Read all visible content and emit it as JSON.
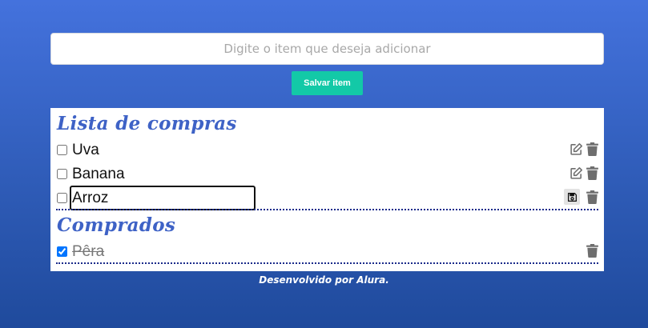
{
  "form": {
    "input_placeholder": "Digite o item que deseja adicionar",
    "input_value": "",
    "save_button_label": "Salvar item"
  },
  "shopping_list": {
    "title": "Lista de compras",
    "items": [
      {
        "label": "Uva",
        "checked": false,
        "editing": false
      },
      {
        "label": "Banana",
        "checked": false,
        "editing": false
      },
      {
        "label": "Arroz",
        "checked": false,
        "editing": true
      }
    ]
  },
  "purchased": {
    "title": "Comprados",
    "items": [
      {
        "label": "Pêra",
        "checked": true
      }
    ]
  },
  "footer": {
    "text": "Desenvolvido por Alura."
  },
  "icons": {
    "edit": "edit-icon",
    "delete": "trash-icon",
    "save": "floppy-disk-icon"
  },
  "colors": {
    "background_top": "#4472dd",
    "background_bottom": "#1f4a9c",
    "save_button": "#13c9a7",
    "section_title": "#3e62c6",
    "icon": "#6e6e6e"
  }
}
